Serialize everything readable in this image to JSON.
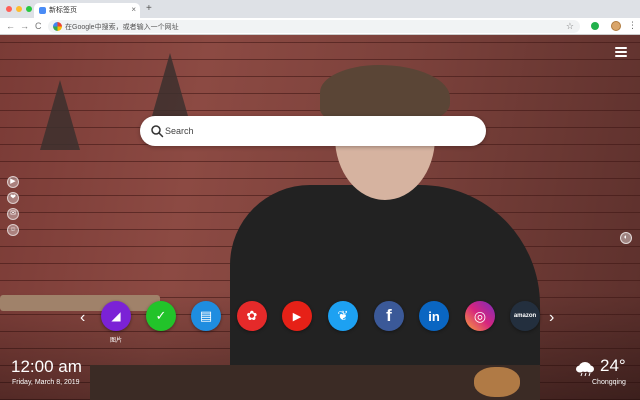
{
  "browser": {
    "tab_title": "新标签页",
    "tab_close": "×",
    "new_tab": "+",
    "back": "←",
    "forward": "→",
    "reload": "C",
    "omnibox_text": "在Google中搜索，或者输入一个网址",
    "star": "☆",
    "menu": "⋮",
    "traffic_lights": [
      "#ff5f57",
      "#febc2e",
      "#28c840"
    ]
  },
  "search": {
    "placeholder": "Search"
  },
  "side_icons": [
    "▶",
    "❤",
    "✉",
    "☺"
  ],
  "shortcuts": [
    {
      "name": "gallery",
      "label": "图片",
      "color": "#7b22d6",
      "glyph": "◢"
    },
    {
      "name": "check",
      "label": "",
      "color": "#22c32a",
      "glyph": "✓"
    },
    {
      "name": "news",
      "label": "",
      "color": "#1f8de0",
      "glyph": "▤"
    },
    {
      "name": "game",
      "label": "",
      "color": "#e52a2a",
      "glyph": "✿"
    },
    {
      "name": "youtube",
      "label": "",
      "color": "#e62117",
      "glyph": "▶"
    },
    {
      "name": "twitter",
      "label": "",
      "color": "#1da1f2",
      "glyph": "❦"
    },
    {
      "name": "facebook",
      "label": "",
      "color": "#3b5998",
      "glyph": "f"
    },
    {
      "name": "linkedin",
      "label": "",
      "color": "#0a66c2",
      "glyph": "in"
    },
    {
      "name": "instagram",
      "label": "",
      "color": "#c13584",
      "glyph": "◎"
    },
    {
      "name": "amazon",
      "label": "",
      "color": "#232f3e",
      "glyph": "amazon"
    }
  ],
  "arrows": {
    "prev": "‹",
    "next": "›"
  },
  "clock": {
    "time": "12:00 am",
    "date": "Friday, March 8, 2019"
  },
  "weather": {
    "temp": "24°",
    "city": "Chongqing",
    "icon": "cloud-icon"
  }
}
